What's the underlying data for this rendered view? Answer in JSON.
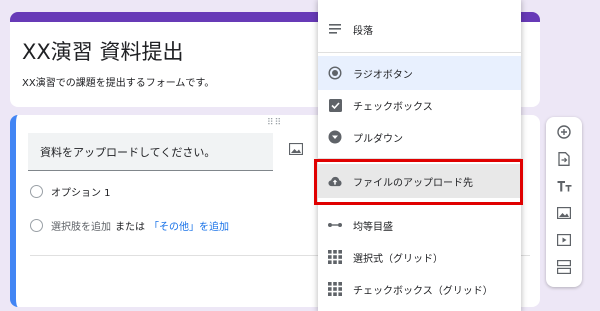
{
  "form": {
    "title": "XX演習 資料提出",
    "description": "XX演習での課題を提出するフォームです。"
  },
  "question": {
    "title": "資料をアップロードしてください。",
    "option1": "オプション 1",
    "add_option": "選択肢を追加",
    "or": "または",
    "add_other": "「その他」を追加"
  },
  "menu": {
    "items": [
      {
        "label": "段落",
        "icon": "paragraph-icon"
      },
      {
        "label": "ラジオボタン",
        "icon": "radio-button-icon"
      },
      {
        "label": "チェックボックス",
        "icon": "checkbox-icon"
      },
      {
        "label": "プルダウン",
        "icon": "dropdown-icon"
      },
      {
        "label": "ファイルのアップロード先",
        "icon": "cloud-upload-icon"
      },
      {
        "label": "均等目盛",
        "icon": "linear-scale-icon"
      },
      {
        "label": "選択式（グリッド）",
        "icon": "grid-icon"
      },
      {
        "label": "チェックボックス（グリッド）",
        "icon": "grid-icon"
      }
    ],
    "selected": "ラジオボタン",
    "highlighted": "ファイルのアップロード先"
  },
  "toolbar": {
    "buttons": [
      "add-question-icon",
      "import-questions-icon",
      "add-title-icon",
      "add-image-icon",
      "add-video-icon",
      "add-section-icon"
    ]
  },
  "colors": {
    "theme": "#673ab7",
    "accent": "#4285f4",
    "link": "#1a73e8",
    "highlight_border": "#e00000",
    "background": "#ede7f6"
  }
}
